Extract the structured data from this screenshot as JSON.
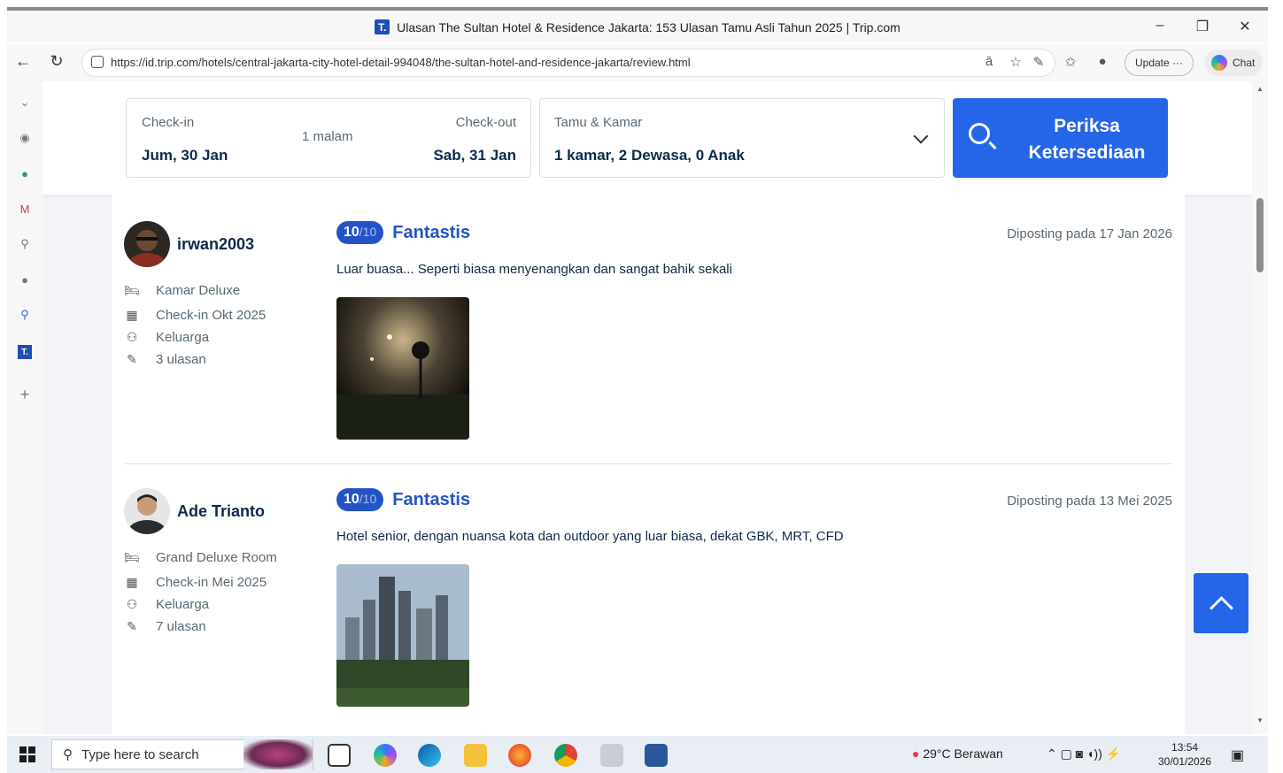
{
  "browser": {
    "tab_title": "Ulasan The Sultan Hotel & Residence Jakarta: 153 Ulasan Tamu Asli Tahun 2025 | Trip.com",
    "url": "https://id.trip.com/hotels/central-jakarta-city-hotel-detail-994048/the-sultan-hotel-and-residence-jakarta/review.html",
    "update_label": "Update",
    "chat_label": "Chat",
    "favicon_letter": "T."
  },
  "search": {
    "checkin_label": "Check-in",
    "checkin_value": "Jum, 30 Jan",
    "nights": "1 malam",
    "checkout_label": "Check-out",
    "checkout_value": "Sab, 31 Jan",
    "guests_label": "Tamu & Kamar",
    "guests_value": "1 kamar, 2 Dewasa, 0 Anak",
    "button_label": "Periksa Ketersediaan"
  },
  "reviews": [
    {
      "user": "irwan2003",
      "room": "Kamar Deluxe",
      "checkin": "Check-in Okt 2025",
      "traveler": "Keluarga",
      "count": "3 ulasan",
      "score": "10",
      "score_den": "/10",
      "score_label": "Fantastis",
      "posted": "Diposting pada 17 Jan 2026",
      "text": "Luar buasa... Seperti biasa menyenangkan dan sangat bahik sekali"
    },
    {
      "user": "Ade Trianto",
      "room": "Grand Deluxe Room",
      "checkin": "Check-in Mei 2025",
      "traveler": "Keluarga",
      "count": "7 ulasan",
      "score": "10",
      "score_den": "/10",
      "score_label": "Fantastis",
      "posted": "Diposting pada 13 Mei 2025",
      "text": "Hotel senior, dengan nuansa kota dan outdoor yang luar biasa, dekat GBK, MRT, CFD"
    }
  ],
  "taskbar": {
    "search_placeholder": "Type here to search",
    "weather": "29°C  Berawan",
    "time": "13:54",
    "date": "30/01/2026"
  },
  "colors": {
    "accent": "#2565e8",
    "score_badge": "#2353c6",
    "text": "#0f294d"
  }
}
